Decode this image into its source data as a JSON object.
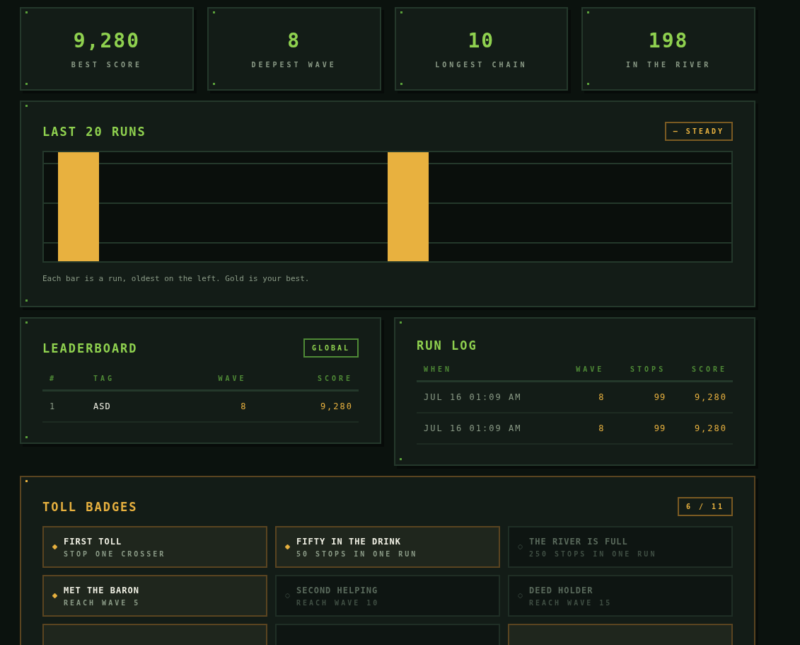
{
  "stats": [
    {
      "value": "9,280",
      "label": "BEST SCORE"
    },
    {
      "value": "8",
      "label": "DEEPEST WAVE"
    },
    {
      "value": "10",
      "label": "LONGEST CHAIN"
    },
    {
      "value": "198",
      "label": "IN THE RIVER"
    }
  ],
  "runs_panel": {
    "title": "LAST 20 RUNS",
    "badge": "— STEADY",
    "caption": "Each bar is a run, oldest on the left. Gold is your best.",
    "bars": [
      {
        "best": true
      },
      {
        "best": false
      },
      {
        "best": false
      },
      {
        "best": false
      },
      {
        "best": false
      },
      {
        "best": false
      },
      {
        "best": false
      },
      {
        "best": false
      },
      {
        "best": true
      },
      {
        "best": false
      },
      {
        "best": false
      },
      {
        "best": false
      },
      {
        "best": false
      },
      {
        "best": false
      },
      {
        "best": false
      },
      {
        "best": false
      }
    ]
  },
  "leaderboard": {
    "title": "LEADERBOARD",
    "scope": "GLOBAL",
    "columns": [
      "#",
      "TAG",
      "WAVE",
      "SCORE"
    ],
    "rows": [
      {
        "rank": "1",
        "tag": "ASD",
        "wave": "8",
        "score": "9,280"
      }
    ]
  },
  "run_log": {
    "title": "RUN LOG",
    "columns": [
      "WHEN",
      "WAVE",
      "STOPS",
      "SCORE"
    ],
    "rows": [
      {
        "when": "JUL 16 01:09 AM",
        "wave": "8",
        "stops": "99",
        "score": "9,280"
      },
      {
        "when": "JUL 16 01:09 AM",
        "wave": "8",
        "stops": "99",
        "score": "9,280"
      }
    ]
  },
  "badges": {
    "title": "TOLL BADGES",
    "count": "6 / 11",
    "items": [
      {
        "name": "FIRST TOLL",
        "desc": "STOP ONE CROSSER",
        "earned": true
      },
      {
        "name": "FIFTY IN THE DRINK",
        "desc": "50 STOPS IN ONE RUN",
        "earned": true
      },
      {
        "name": "THE RIVER IS FULL",
        "desc": "250 STOPS IN ONE RUN",
        "earned": false
      },
      {
        "name": "MET THE BARON",
        "desc": "REACH WAVE 5",
        "earned": true
      },
      {
        "name": "SECOND HELPING",
        "desc": "REACH WAVE 10",
        "earned": false
      },
      {
        "name": "DEED HOLDER",
        "desc": "REACH WAVE 15",
        "earned": false
      },
      {
        "earned": true
      },
      {
        "earned": false
      },
      {
        "earned": true
      }
    ]
  }
}
